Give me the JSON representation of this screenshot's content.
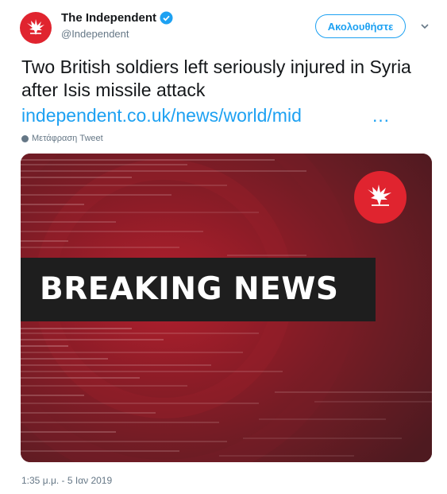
{
  "account": {
    "display_name": "The Independent",
    "handle": "@Independent",
    "verified_icon": "verified-badge-icon",
    "avatar_icon": "eagle-logo-icon"
  },
  "follow_button": {
    "label": "Ακολουθήστε"
  },
  "menu": {
    "icon": "chevron-down-icon"
  },
  "tweet": {
    "text": "Two British soldiers left seriously injured in Syria after Isis missile attack",
    "link": "independent.co.uk/news/world/mid",
    "link_ellipsis": "…",
    "translate_label": "Μετάφραση Tweet",
    "timestamp": "1:35 μ.μ. - 5 Ιαν 2019"
  },
  "media": {
    "banner_text": "BREAKING NEWS",
    "logo_icon": "eagle-logo-icon"
  },
  "colors": {
    "accent": "#1da1f2",
    "brand_red": "#e0242f",
    "card_bg": "#5c1e24",
    "banner_bg": "#1e1e1e",
    "muted": "#657786"
  }
}
